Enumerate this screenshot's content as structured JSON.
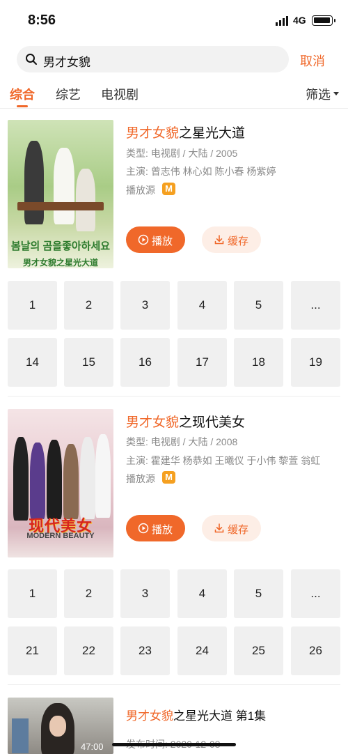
{
  "status_bar": {
    "time": "8:56",
    "network": "4G"
  },
  "search": {
    "query": "男才女貌",
    "cancel_label": "取消"
  },
  "tabs": [
    {
      "label": "综合"
    },
    {
      "label": "综艺"
    },
    {
      "label": "电视剧"
    }
  ],
  "filter_label": "筛选",
  "results": [
    {
      "title_highlight": "男才女貌",
      "title_rest": "之星光大道",
      "type_line": "类型: 电视剧 / 大陆 / 2005",
      "cast_line": "主演: 曾志伟 林心如 陈小春 杨紫婷",
      "source_label": "播放源",
      "source_icon": "M",
      "play_label": "播放",
      "cache_label": "缓存",
      "poster_korean": "봄날의 곰을좋아하세요",
      "poster_cn": "男才女貌之星光大道",
      "episodes": [
        "1",
        "2",
        "3",
        "4",
        "5",
        "...",
        "14",
        "15",
        "16",
        "17",
        "18",
        "19"
      ]
    },
    {
      "title_highlight": "男才女貌",
      "title_rest": "之现代美女",
      "type_line": "类型: 电视剧 / 大陆 / 2008",
      "cast_line": "主演: 霍建华 杨恭如 王曦仪 于小伟 黎萱 翁虹",
      "source_label": "播放源",
      "source_icon": "M",
      "play_label": "播放",
      "cache_label": "缓存",
      "poster_title": "现代美女",
      "poster_en": "MODERN BEAUTY",
      "episodes": [
        "1",
        "2",
        "3",
        "4",
        "5",
        "...",
        "21",
        "22",
        "23",
        "24",
        "25",
        "26"
      ]
    },
    {
      "title_highlight": "男才女貌",
      "title_rest": "之星光大道 第1集",
      "date_line": "发布时间: 2020-12-08",
      "duration": "47:00"
    }
  ],
  "colors": {
    "accent": "#f0682a",
    "cache_bg": "#fdeee6",
    "tile_bg": "#f0f0f0",
    "meta_text": "#8a8a8a"
  }
}
